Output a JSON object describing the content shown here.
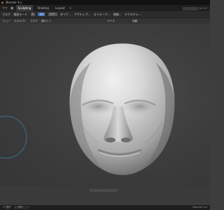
{
  "window": {
    "title": "Blender 4.x"
  },
  "menus": [
    "ファ",
    "編"
  ],
  "workspace_tabs": [
    {
      "label": "Sculpting",
      "active": true
    },
    {
      "label": "Shading",
      "active": false
    },
    {
      "label": "Layout",
      "active": false
    }
  ],
  "add_tab": "+",
  "scene_label": "シーン",
  "toolbar": {
    "mode_label": "マスク",
    "mode_value": "描画モード",
    "chips": [
      "追加",
      "ミラー"
    ],
    "icon_chip": "✎",
    "items": [
      "ダイナ...",
      "アクティブ...",
      "ストローク...",
      "曲線...",
      "テクスチャ..."
    ]
  },
  "header": {
    "items": [
      "ビュー",
      "スカルプト",
      "マスク",
      "面セット"
    ],
    "right_items": [
      "X Y Z",
      "自動"
    ]
  },
  "statusbar": {
    "left": [
      "⊙ 選択",
      "◎ 回転ビュー"
    ],
    "right": "Blender 4.x"
  },
  "colors": {
    "accent": "#3f6db5",
    "viewport_bg": "#3c3c3c",
    "gizmo": "#3a6f8f"
  },
  "icons": [
    "blender-logo",
    "brush-icon",
    "gizmo-circle"
  ]
}
